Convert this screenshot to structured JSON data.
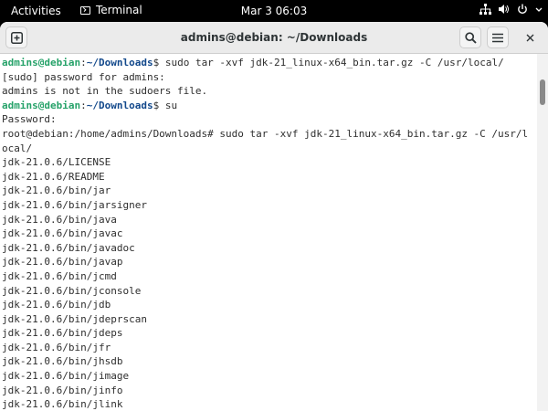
{
  "topbar": {
    "activities": "Activities",
    "app_name": "Terminal",
    "clock": "Mar 3  06:03",
    "icons": [
      "network-icon",
      "volume-icon",
      "power-icon"
    ]
  },
  "window": {
    "title": "admins@debian: ~/Downloads",
    "icons": [
      "new-tab-icon",
      "search-icon",
      "hamburger-menu-icon",
      "close-icon"
    ]
  },
  "terminal": {
    "lines": [
      {
        "kind": "prompt",
        "user": "admins@debian",
        "sep": ":",
        "path": "~/Downloads",
        "suffix": "$ ",
        "cmd": "sudo tar -xvf jdk-21_linux-x64_bin.tar.gz -C /usr/local/"
      },
      {
        "kind": "text",
        "text": "[sudo] password for admins:"
      },
      {
        "kind": "text",
        "text": "admins is not in the sudoers file."
      },
      {
        "kind": "prompt",
        "user": "admins@debian",
        "sep": ":",
        "path": "~/Downloads",
        "suffix": "$ ",
        "cmd": "su"
      },
      {
        "kind": "text",
        "text": "Password:"
      },
      {
        "kind": "text",
        "text": "root@debian:/home/admins/Downloads# sudo tar -xvf jdk-21_linux-x64_bin.tar.gz -C /usr/l"
      },
      {
        "kind": "text",
        "text": "ocal/"
      },
      {
        "kind": "text",
        "text": "jdk-21.0.6/LICENSE"
      },
      {
        "kind": "text",
        "text": "jdk-21.0.6/README"
      },
      {
        "kind": "text",
        "text": "jdk-21.0.6/bin/jar"
      },
      {
        "kind": "text",
        "text": "jdk-21.0.6/bin/jarsigner"
      },
      {
        "kind": "text",
        "text": "jdk-21.0.6/bin/java"
      },
      {
        "kind": "text",
        "text": "jdk-21.0.6/bin/javac"
      },
      {
        "kind": "text",
        "text": "jdk-21.0.6/bin/javadoc"
      },
      {
        "kind": "text",
        "text": "jdk-21.0.6/bin/javap"
      },
      {
        "kind": "text",
        "text": "jdk-21.0.6/bin/jcmd"
      },
      {
        "kind": "text",
        "text": "jdk-21.0.6/bin/jconsole"
      },
      {
        "kind": "text",
        "text": "jdk-21.0.6/bin/jdb"
      },
      {
        "kind": "text",
        "text": "jdk-21.0.6/bin/jdeprscan"
      },
      {
        "kind": "text",
        "text": "jdk-21.0.6/bin/jdeps"
      },
      {
        "kind": "text",
        "text": "jdk-21.0.6/bin/jfr"
      },
      {
        "kind": "text",
        "text": "jdk-21.0.6/bin/jhsdb"
      },
      {
        "kind": "text",
        "text": "jdk-21.0.6/bin/jimage"
      },
      {
        "kind": "text",
        "text": "jdk-21.0.6/bin/jinfo"
      },
      {
        "kind": "text",
        "text": "jdk-21.0.6/bin/jlink"
      }
    ]
  },
  "colors": {
    "prompt_user": "#26a269",
    "prompt_path": "#12488b",
    "terminal_text": "#2e2e2e",
    "terminal_bg": "#ffffff",
    "topbar_bg": "#000000"
  }
}
